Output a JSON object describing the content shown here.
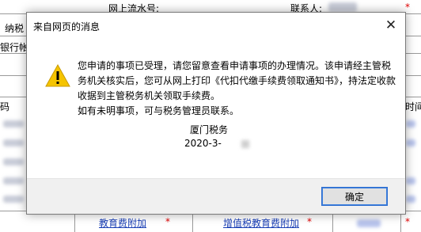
{
  "background": {
    "serial_label": "网上流水号:",
    "contact_label": "联系人:",
    "required_mark": "*",
    "left_labels": [
      "纳税",
      "银行帐",
      "码"
    ],
    "right_labels": [
      "时间"
    ],
    "bottom_links": [
      "教育费附加",
      "增值税教育费附加"
    ]
  },
  "dialog": {
    "title": "来自网页的消息",
    "close_symbol": "✕",
    "icon": "warning-icon",
    "message": [
      "您申请的事项已受理，请您留意查看申请事项的办理情况。该申请经主管税务机关核实后，您可从网上打印《代扣代缴手续费领取通知书》，持法定收款收据到主管税务机关领取手续费。",
      "如有未明事项，可与税务管理员联系。"
    ],
    "signature_org": "厦门税务",
    "signature_date": "2020-3-",
    "ok_label": "确定"
  },
  "colors": {
    "warning_yellow": "#f5c400",
    "ok_border": "#2f6fcf",
    "link": "#1a3fb5",
    "required": "#e00000"
  }
}
